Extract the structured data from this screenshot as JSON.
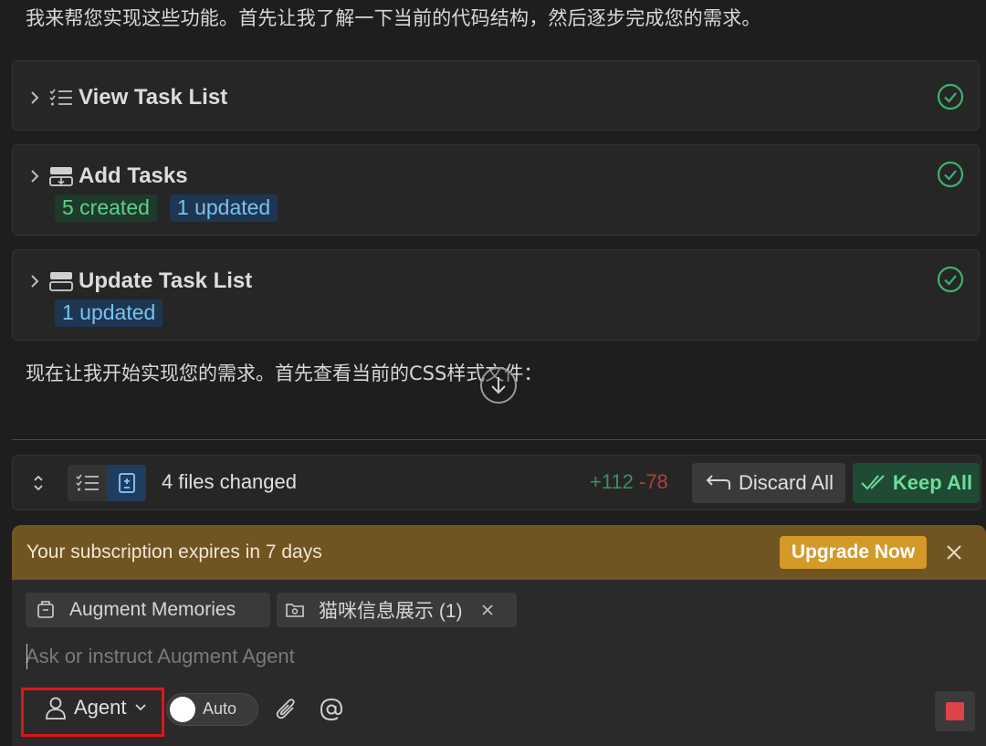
{
  "conversation": {
    "intro_text": "我来帮您实现这些功能。首先让我了解一下当前的代码结构，然后逐步完成您的需求。",
    "status_text": "现在让我开始实现您的需求。首先查看当前的CSS样式文件："
  },
  "cards": [
    {
      "title": "View Task List",
      "icon": "task-list-icon",
      "status": "completed",
      "tags": []
    },
    {
      "title": "Add Tasks",
      "icon": "add-tasks-icon",
      "status": "completed",
      "tags": [
        {
          "label": "5 created",
          "kind": "green"
        },
        {
          "label": "1 updated",
          "kind": "blue"
        }
      ]
    },
    {
      "title": "Update Task List",
      "icon": "update-tasks-icon",
      "status": "completed",
      "tags": [
        {
          "label": "1 updated",
          "kind": "blue"
        }
      ]
    }
  ],
  "files_bar": {
    "files_changed": "4 files changed",
    "additions": "+112",
    "deletions": "-78",
    "discard_label": "Discard All",
    "keep_label": "Keep All"
  },
  "banner": {
    "text": "Your subscription expires in 7 days",
    "upgrade_label": "Upgrade Now"
  },
  "chips": {
    "memories": "Augment Memories",
    "context": "猫咪信息展示 (1)"
  },
  "input": {
    "placeholder": "Ask or instruct Augment Agent"
  },
  "toolbar": {
    "agent_label": "Agent",
    "auto_label": "Auto"
  },
  "colors": {
    "background": "#1e1e1e",
    "card": "#262626",
    "check": "#3fb06e",
    "banner": "#705422",
    "upgrade": "#d39a2a",
    "highlight": "#e0141b",
    "stop": "#e0424a"
  }
}
